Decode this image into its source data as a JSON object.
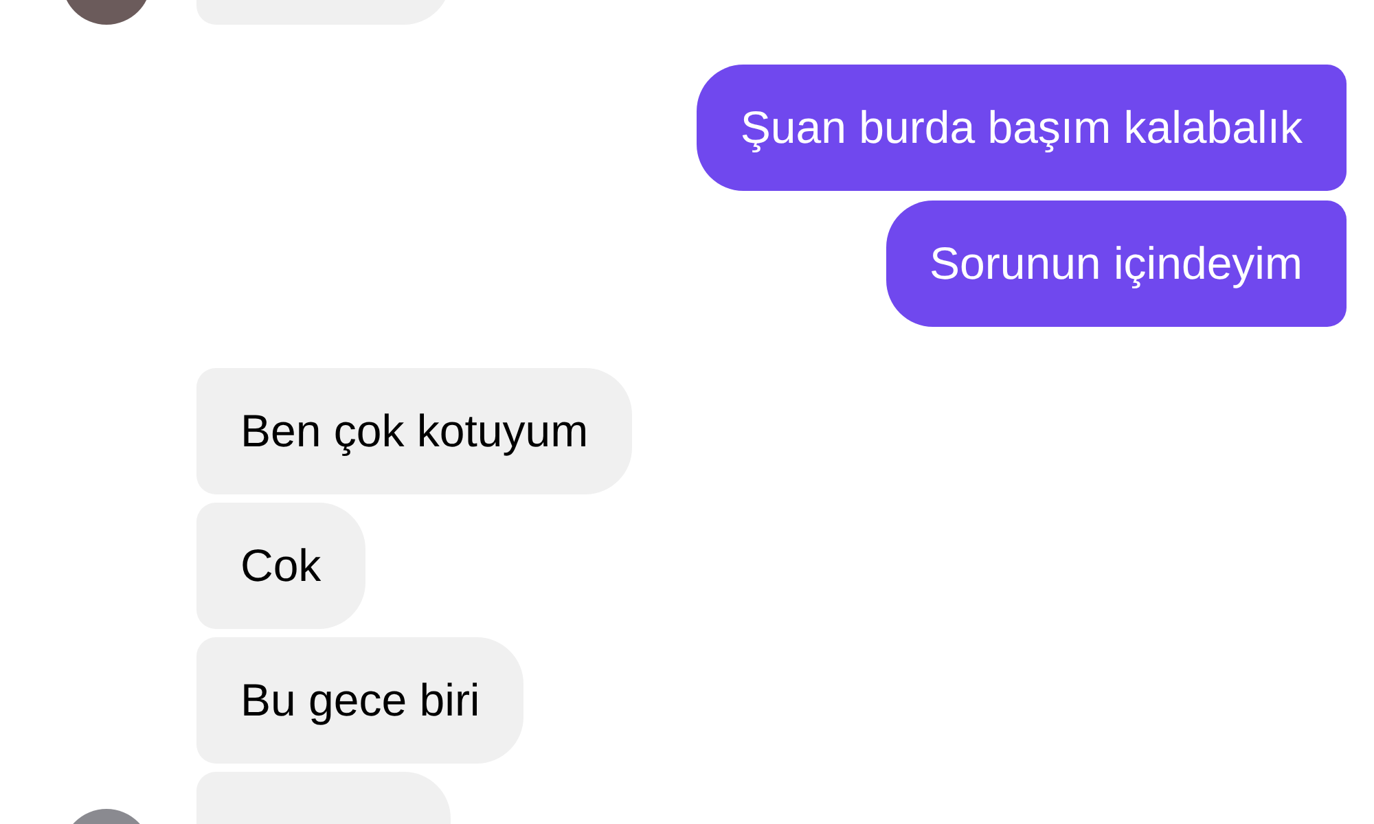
{
  "messages": [
    {
      "kind": "received",
      "avatar": true
    },
    {
      "kind": "sent",
      "text": "Şuan burda başım kalabalık"
    },
    {
      "kind": "sent",
      "text": "Sorunun içindeyim"
    },
    {
      "kind": "received",
      "avatar": false,
      "text": "Ben çok kotuyum"
    },
    {
      "kind": "received",
      "avatar": false,
      "text": "Cok"
    },
    {
      "kind": "received",
      "avatar": false,
      "text": "Bu gece biri"
    },
    {
      "kind": "received",
      "avatar": true
    }
  ]
}
